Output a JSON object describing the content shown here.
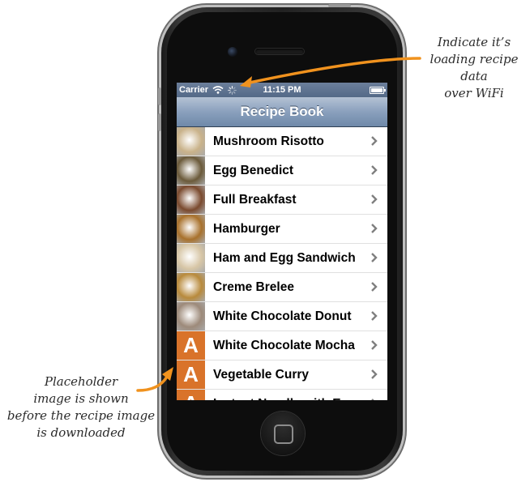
{
  "status_bar": {
    "carrier": "Carrier",
    "time": "11:15 PM"
  },
  "nav": {
    "title": "Recipe Book"
  },
  "recipes": [
    {
      "name": "Mushroom Risotto",
      "thumb": "photo",
      "color": "#c9b28a"
    },
    {
      "name": "Egg Benedict",
      "thumb": "photo",
      "color": "#6b5a3a"
    },
    {
      "name": "Full Breakfast",
      "thumb": "photo",
      "color": "#7a4a2e"
    },
    {
      "name": "Hamburger",
      "thumb": "photo",
      "color": "#a8712c"
    },
    {
      "name": "Ham and Egg Sandwich",
      "thumb": "photo",
      "color": "#d7c6a6"
    },
    {
      "name": "Creme Brelee",
      "thumb": "photo",
      "color": "#b88a3c"
    },
    {
      "name": "White Chocolate Donut",
      "thumb": "photo",
      "color": "#9d8a7a"
    },
    {
      "name": "White Chocolate Mocha",
      "thumb": "placeholder",
      "color": "#d9732a"
    },
    {
      "name": "Vegetable Curry",
      "thumb": "placeholder",
      "color": "#d9732a"
    },
    {
      "name": "Instant Noodle with Egg",
      "thumb": "placeholder",
      "color": "#d9732a"
    }
  ],
  "placeholder_letter": "A",
  "annotations": {
    "top_right": [
      "Indicate it’s",
      "loading recipe",
      "data",
      "over WiFi"
    ],
    "bottom_left": [
      "Placeholder",
      "image is shown",
      "before the recipe image",
      "is downloaded"
    ]
  },
  "colors": {
    "arrow": "#f0921e",
    "placeholder": "#d9732a",
    "nav_top": "#b4c2d4",
    "nav_bottom": "#6f89a9"
  }
}
